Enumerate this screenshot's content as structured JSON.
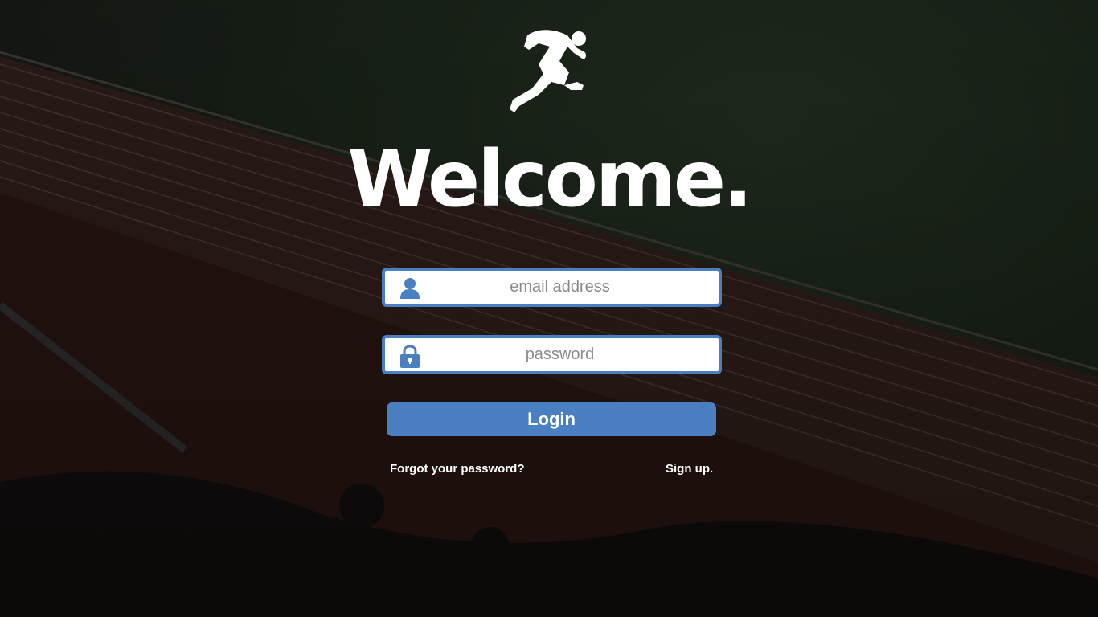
{
  "header": {
    "title": "Welcome."
  },
  "form": {
    "email": {
      "placeholder": "email address",
      "value": "",
      "icon": "user-icon"
    },
    "password": {
      "placeholder": "password",
      "value": "",
      "icon": "lock-icon"
    },
    "login_label": "Login"
  },
  "links": {
    "forgot": "Forgot your password?",
    "signup": "Sign up."
  },
  "colors": {
    "accent": "#4a7fc1",
    "text": "#ffffff"
  }
}
